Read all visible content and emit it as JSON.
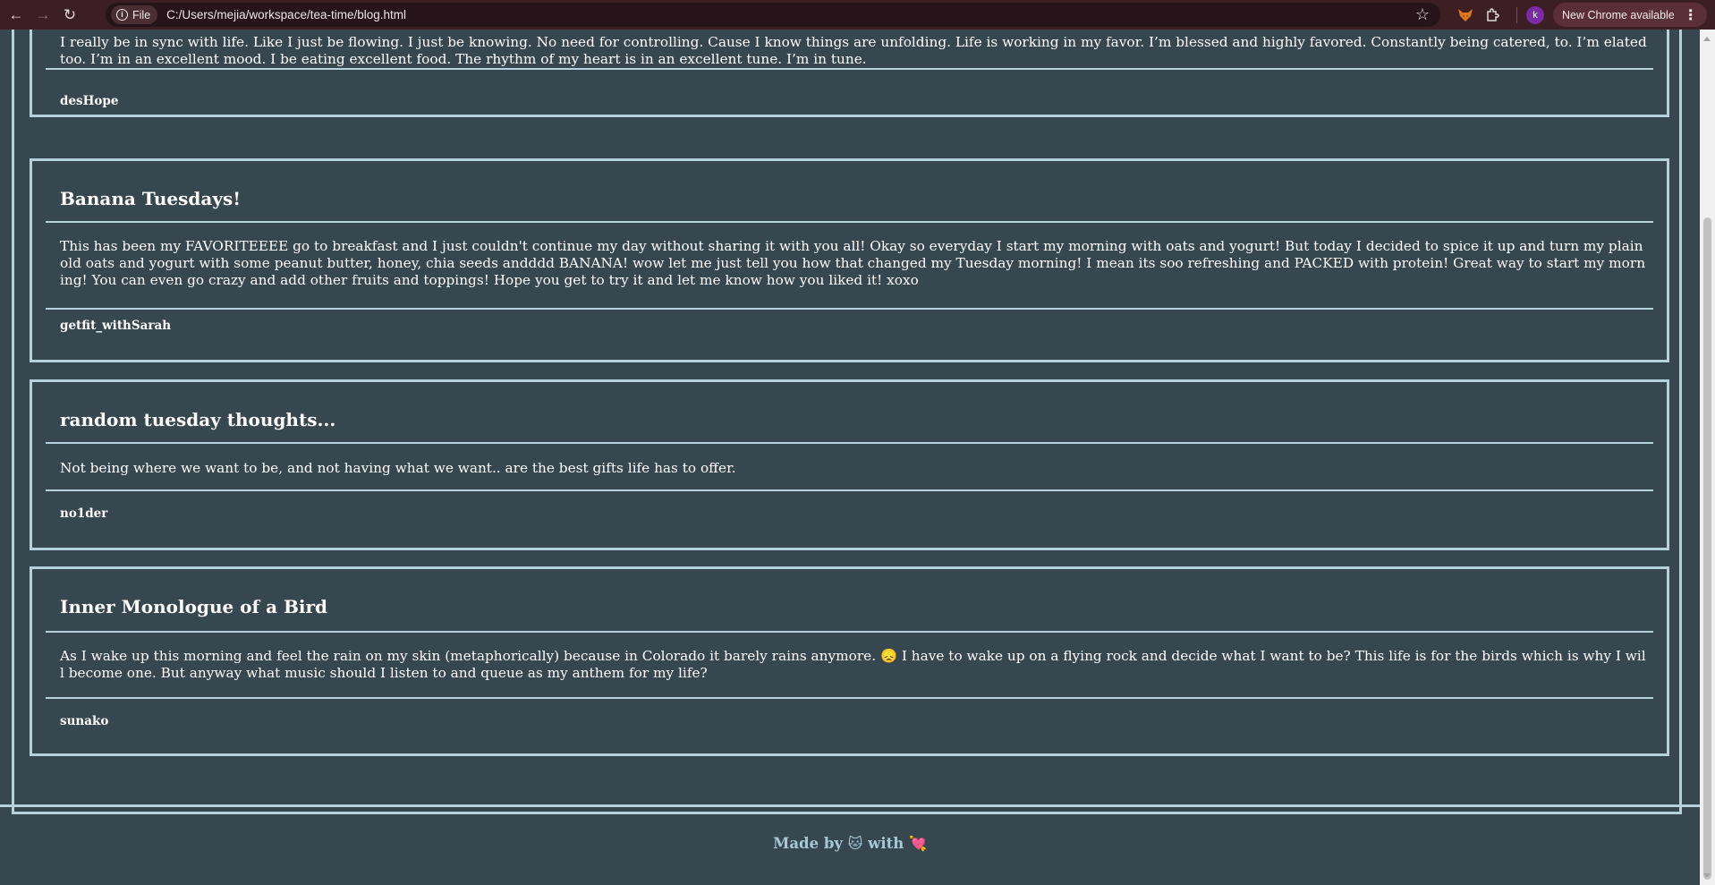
{
  "browser": {
    "back_icon": "arrow-left-icon",
    "forward_icon": "arrow-right-icon",
    "reload_icon": "reload-icon",
    "scheme_label": "File",
    "url": "C:/Users/mejia/workspace/tea-time/blog.html",
    "bookmark_icon": "star-icon",
    "profile_initial": "k",
    "update_label": "New Chrome available"
  },
  "posts": [
    {
      "body": "I really be in sync with life. Like I just be flowing. I just be knowing. No need for controlling. Cause I know things are unfolding. Life is working in my favor. I’m blessed and highly favored. Constantly being catered, to. I’m elated too. I’m in an excellent mood. I be eating excellent food. The rhythm of my heart is in an excellent tune. I’m in tune.",
      "author": "desHope"
    },
    {
      "title": "Banana Tuesdays!",
      "body": "This has been my FAVORITEEEE go to breakfast and I just couldn't continue my day without sharing it with you all! Okay so everyday I start my morning with oats and yogurt! But today I decided to spice it up and turn my plain old oats and yogurt with some peanut butter, honey, chia seeds andddd BANANA! wow let me just tell you how that changed my Tuesday morning! I mean its soo refreshing and PACKED with protein! Great way to start my morning! You can even go crazy and add other fruits and toppings! Hope you get to try it and let me know how you liked it! xoxo",
      "author": "getfit_withSarah"
    },
    {
      "title": "random tuesday thoughts...",
      "body": "Not being where we want to be, and not having what we want.. are the best gifts life has to offer.",
      "author": "no1der"
    },
    {
      "title": "Inner Monologue of a Bird",
      "body": "As I wake up this morning and feel the rain on my skin (metaphorically) because in Colorado it barely rains anymore. 😞 I have to wake up on a flying rock and decide what I want to be? This life is for the birds which is why I will become one. But anyway what music should I listen to and queue as my anthem for my life?",
      "author": "sunako"
    }
  ],
  "footer": {
    "made_by": "Made by",
    "cat_emoji": "🐱",
    "with": "with",
    "heart_emoji": "💘"
  },
  "colors": {
    "page_bg": "#37474f",
    "border": "#b6d0dc",
    "footer_text": "#a8c8d6",
    "chrome_bg": "#3b1f24"
  }
}
